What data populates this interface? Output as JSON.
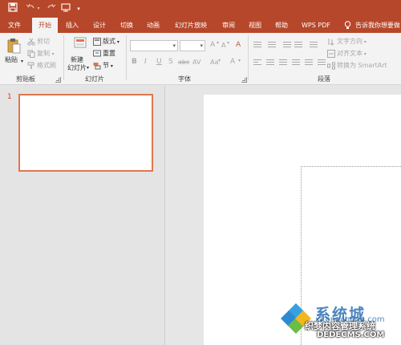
{
  "qat": {
    "save_icon": "save-icon",
    "undo_icon": "undo-icon",
    "redo_icon": "redo-icon",
    "start_icon": "slideshow-start-icon",
    "customize_icon": "customize-qat-icon"
  },
  "tabs": [
    {
      "label": "文件"
    },
    {
      "label": "开始"
    },
    {
      "label": "插入"
    },
    {
      "label": "设计"
    },
    {
      "label": "切换"
    },
    {
      "label": "动画"
    },
    {
      "label": "幻灯片放映"
    },
    {
      "label": "审阅"
    },
    {
      "label": "视图"
    },
    {
      "label": "帮助"
    },
    {
      "label": "WPS PDF"
    },
    {
      "label": "告诉我你想要做"
    }
  ],
  "active_tab": "开始",
  "ribbon": {
    "clipboard": {
      "paste": "粘贴",
      "cut": "剪切",
      "copy": "复制",
      "format_painter": "格式刷",
      "group_label": "剪贴板"
    },
    "slides": {
      "new_slide_line1": "新建",
      "new_slide_line2": "幻灯片",
      "layout": "版式",
      "reset": "重置",
      "section": "节",
      "group_label": "幻灯片"
    },
    "font": {
      "group_label": "字体",
      "bold": "B",
      "italic": "I",
      "underline": "U",
      "shadow": "S",
      "strike": "abc",
      "spacing": "AV",
      "case": "Aa",
      "color": "A",
      "grow": "A",
      "shrink": "A",
      "clear": "A"
    },
    "paragraph": {
      "group_label": "段落",
      "text_direction": "文字方向",
      "align_text": "对齐文本",
      "smartart": "转换为 SmartArt"
    }
  },
  "slides_pane": {
    "slide_number": "1"
  },
  "watermark": {
    "brand": "系统城",
    "domain": "xitongcheng.com",
    "cn_name": "织梦内容管理系统",
    "url": "DEDECMS.COM"
  },
  "colors": {
    "accent": "#b7472a",
    "selected_thumb_border": "#e07650"
  }
}
